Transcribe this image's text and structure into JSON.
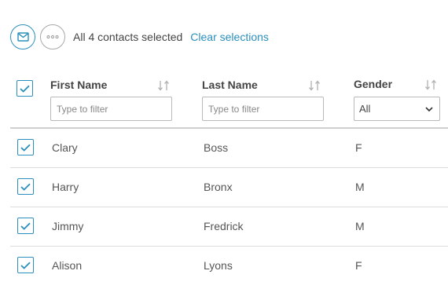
{
  "toolbar": {
    "selection_text": "All 4 contacts selected",
    "clear_label": "Clear selections",
    "mail_icon": "mail-icon",
    "more_icon": "more-horizontal-icon"
  },
  "columns": [
    {
      "label": "First Name",
      "placeholder": "Type to filter"
    },
    {
      "label": "Last Name",
      "placeholder": "Type to filter"
    },
    {
      "label": "Gender",
      "select_value": "All"
    }
  ],
  "rows": [
    {
      "first": "Clary",
      "last": "Boss",
      "gender": "F",
      "checked": true
    },
    {
      "first": "Harry",
      "last": "Bronx",
      "gender": "M",
      "checked": true
    },
    {
      "first": "Jimmy",
      "last": "Fredrick",
      "gender": "M",
      "checked": true
    },
    {
      "first": "Alison",
      "last": "Lyons",
      "gender": "F",
      "checked": true
    }
  ],
  "colors": {
    "accent": "#2a8fbd",
    "text": "#444444",
    "border": "#b9b9b9"
  }
}
